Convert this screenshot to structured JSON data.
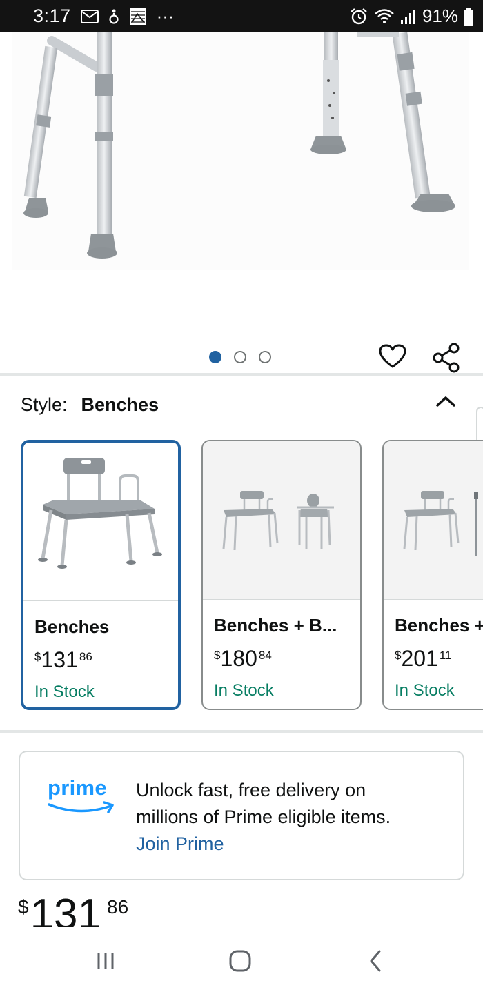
{
  "status_bar": {
    "time": "3:17",
    "icons_left": [
      "mail-icon",
      "accessibility-icon",
      "gallery-icon",
      "more-icon"
    ],
    "overflow": "···",
    "icons_right": [
      "alarm-icon",
      "wifi-icon",
      "signal-icon"
    ],
    "battery": "91%"
  },
  "gallery": {
    "image_count": 3,
    "active_index": 0
  },
  "style": {
    "label": "Style:",
    "value": "Benches"
  },
  "swatches": [
    {
      "name": "Benches",
      "price_symbol": "$",
      "price_whole": "131",
      "price_fraction": "86",
      "stock": "In Stock",
      "selected": true
    },
    {
      "name": "Benches + B...",
      "price_symbol": "$",
      "price_whole": "180",
      "price_fraction": "84",
      "stock": "In Stock",
      "selected": false
    },
    {
      "name": "Benches +",
      "price_symbol": "$",
      "price_whole": "201",
      "price_fraction": "11",
      "stock": "In Stock",
      "selected": false
    }
  ],
  "prime": {
    "logo": "prime",
    "line1": "Unlock fast, free delivery on",
    "line2": "millions of Prime eligible items.",
    "link": "Join Prime"
  },
  "price": {
    "symbol": "$",
    "whole": "131",
    "fraction": "86"
  },
  "colors": {
    "link": "#2162a1",
    "stock": "#067d62",
    "prime": "#1a98ff",
    "status_bar": "#131313"
  }
}
